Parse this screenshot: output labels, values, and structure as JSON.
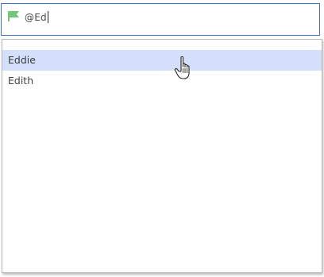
{
  "input": {
    "value": "@Ed",
    "flag_icon": "flag-icon",
    "flag_color": "#74c67b"
  },
  "suggestions": {
    "items": [
      {
        "label": "Eddie",
        "selected": true
      },
      {
        "label": "Edith",
        "selected": false
      }
    ],
    "highlight_color": "#d3dffb"
  },
  "pointer": {
    "icon": "hand-pointer-icon"
  }
}
